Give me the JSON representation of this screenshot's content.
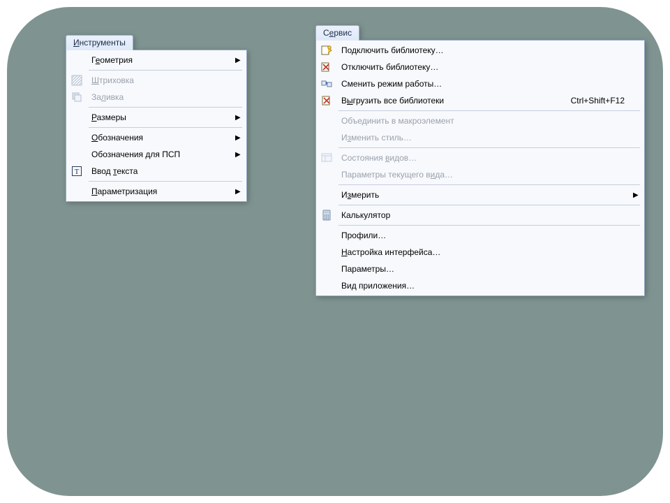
{
  "menus": {
    "instruments": {
      "tab_html": "<u>И</u>нструменты",
      "items": [
        {
          "label_html": "Г<u>е</u>ометрия",
          "submenu": true,
          "enabled": true,
          "icon": null
        },
        {
          "sep": true
        },
        {
          "label_html": "<u>Ш</u>триховка",
          "submenu": false,
          "enabled": false,
          "icon": "hatch-icon"
        },
        {
          "label_html": "За<u>л</u>ивка",
          "submenu": false,
          "enabled": false,
          "icon": "fill-icon"
        },
        {
          "sep": true
        },
        {
          "label_html": "<u>Р</u>азмеры",
          "submenu": true,
          "enabled": true,
          "icon": null
        },
        {
          "sep": true
        },
        {
          "label_html": "<u>О</u>бозначения",
          "submenu": true,
          "enabled": true,
          "icon": null
        },
        {
          "label_html": "Обозначения для ПСП",
          "submenu": true,
          "enabled": true,
          "icon": null
        },
        {
          "label_html": "Ввод <u>т</u>екста",
          "submenu": false,
          "enabled": true,
          "icon": "text-icon"
        },
        {
          "sep": true
        },
        {
          "label_html": "<u>П</u>араметризация",
          "submenu": true,
          "enabled": true,
          "icon": null
        }
      ]
    },
    "service": {
      "tab_html": "С<u>е</u>рвис",
      "items": [
        {
          "label_html": "Подключить библиотеку…",
          "submenu": false,
          "enabled": true,
          "icon": "lib-connect-icon"
        },
        {
          "label_html": "Отключить библиотеку…",
          "submenu": false,
          "enabled": true,
          "icon": "lib-disconnect-icon"
        },
        {
          "label_html": "Сменить режим работы…",
          "submenu": false,
          "enabled": true,
          "icon": "mode-switch-icon"
        },
        {
          "label_html": "В<u>ы</u>грузить все библиотеки",
          "shortcut": "Ctrl+Shift+F12",
          "submenu": false,
          "enabled": true,
          "icon": "lib-unload-icon"
        },
        {
          "sep": true
        },
        {
          "label_html": "Объединить в макроэлемент",
          "submenu": false,
          "enabled": false,
          "icon": null
        },
        {
          "label_html": "И<u>з</u>менить стиль…",
          "submenu": false,
          "enabled": false,
          "icon": null
        },
        {
          "sep": true
        },
        {
          "label_html": "Состояния <u>в</u>идов…",
          "submenu": false,
          "enabled": false,
          "icon": "view-state-icon"
        },
        {
          "label_html": "Параметры текущего в<u>и</u>да…",
          "submenu": false,
          "enabled": false,
          "icon": null
        },
        {
          "sep": true
        },
        {
          "label_html": "И<u>з</u>мерить",
          "submenu": true,
          "enabled": true,
          "icon": null
        },
        {
          "sep": true
        },
        {
          "label_html": "Калькулятор",
          "submenu": false,
          "enabled": true,
          "icon": "calculator-icon"
        },
        {
          "sep": true
        },
        {
          "label_html": "Профили…",
          "submenu": false,
          "enabled": true,
          "icon": null
        },
        {
          "label_html": "<u>Н</u>астройка интерфейса…",
          "submenu": false,
          "enabled": true,
          "icon": null
        },
        {
          "label_html": "Параметры…",
          "submenu": false,
          "enabled": true,
          "icon": null
        },
        {
          "label_html": "Вид приложения…",
          "submenu": false,
          "enabled": true,
          "icon": null
        }
      ]
    }
  }
}
